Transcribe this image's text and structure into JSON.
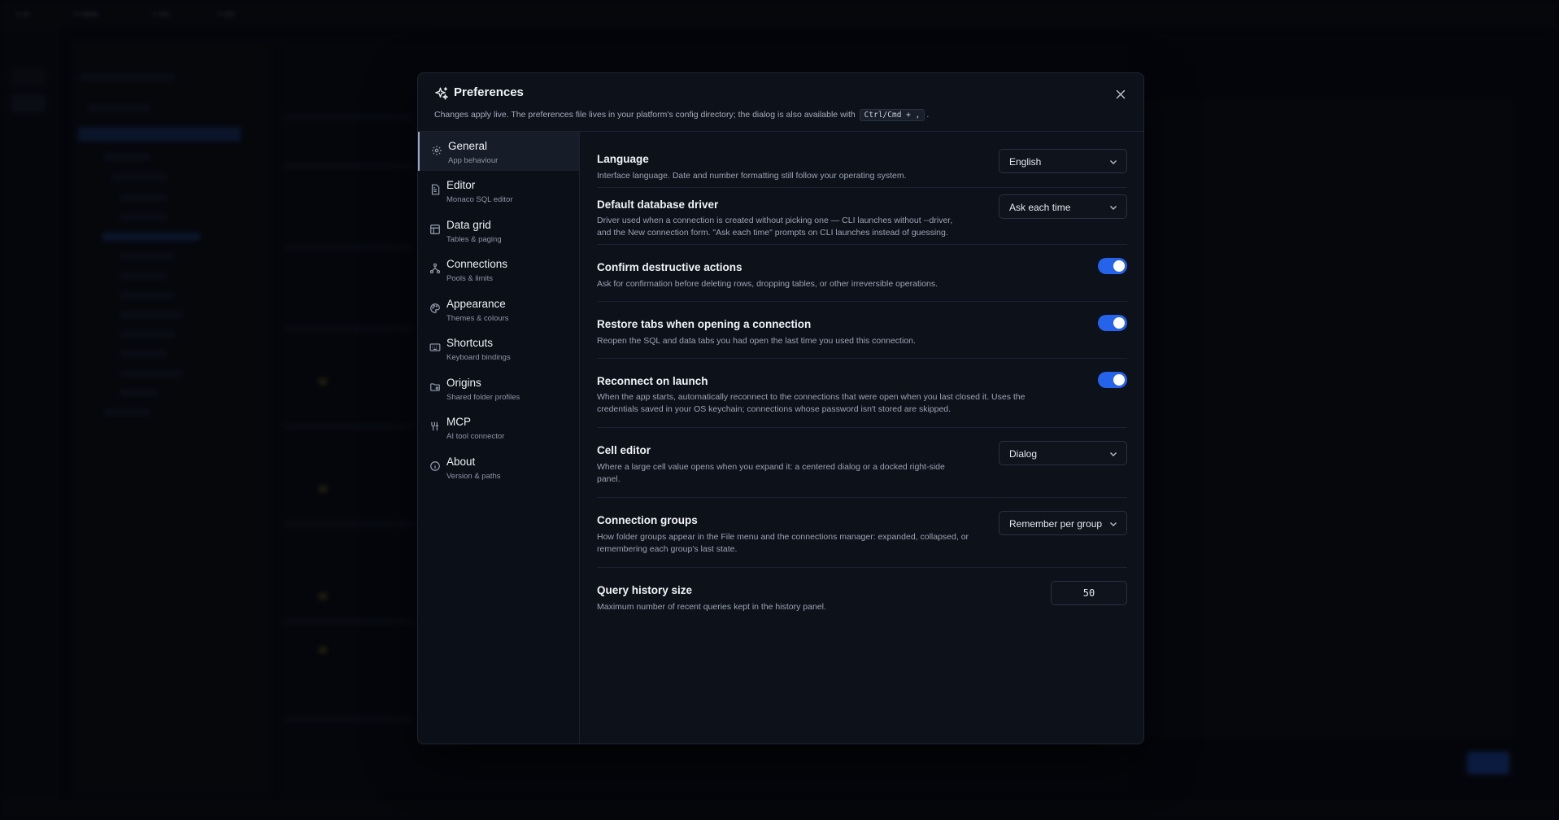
{
  "dialog": {
    "title": "Preferences",
    "subtitle_before": "Changes apply live. The preferences file lives in your platform's config directory; the dialog is also available with",
    "shortcut": "Ctrl/Cmd + ,",
    "subtitle_after": ".",
    "title_icon": "sparkles-icon",
    "close_icon": "close-icon"
  },
  "sidebar": {
    "items": [
      {
        "label": "General",
        "sub": "App behaviour",
        "icon": "gear-icon",
        "active": true
      },
      {
        "label": "Editor",
        "sub": "Monaco SQL editor",
        "icon": "file-code-icon",
        "active": false
      },
      {
        "label": "Data grid",
        "sub": "Tables & paging",
        "icon": "table-icon",
        "active": false
      },
      {
        "label": "Connections",
        "sub": "Pools & limits",
        "icon": "network-icon",
        "active": false
      },
      {
        "label": "Appearance",
        "sub": "Themes & colours",
        "icon": "palette-icon",
        "active": false
      },
      {
        "label": "Shortcuts",
        "sub": "Keyboard bindings",
        "icon": "keyboard-icon",
        "active": false
      },
      {
        "label": "Origins",
        "sub": "Shared folder profiles",
        "icon": "folder-share-icon",
        "active": false
      },
      {
        "label": "MCP",
        "sub": "AI tool connector",
        "icon": "plug-icon",
        "active": false
      },
      {
        "label": "About",
        "sub": "Version & paths",
        "icon": "info-icon",
        "active": false
      }
    ]
  },
  "settings": {
    "language": {
      "title": "Language",
      "desc": "Interface language. Date and number formatting still follow your operating system.",
      "value": "English"
    },
    "driver": {
      "title": "Default database driver",
      "desc1": "Driver used when a connection is created without picking one — CLI launches without --driver,",
      "desc2": "and the New connection form. \"Ask each time\" prompts on CLI launches instead of guessing.",
      "value": "Ask each time"
    },
    "confirm": {
      "title": "Confirm destructive actions",
      "desc": "Ask for confirmation before deleting rows, dropping tables, or other irreversible operations.",
      "enabled": true
    },
    "restore": {
      "title": "Restore tabs when opening a connection",
      "desc": "Reopen the SQL and data tabs you had open the last time you used this connection.",
      "enabled": true
    },
    "reconnect": {
      "title": "Reconnect on launch",
      "desc1": "When the app starts, automatically reconnect to the connections that were open when you last closed it. Uses the",
      "desc2": "credentials saved in your OS keychain; connections whose password isn't stored are skipped.",
      "enabled": true
    },
    "cell_editor": {
      "title": "Cell editor",
      "desc1": "Where a large cell value opens when you expand it: a centered dialog or a docked right-side",
      "desc2": "panel.",
      "value": "Dialog"
    },
    "groups": {
      "title": "Connection groups",
      "desc1": "How folder groups appear in the File menu and the connections manager: expanded, collapsed, or",
      "desc2": "remembering each group's last state.",
      "value": "Remember per group"
    },
    "history": {
      "title": "Query history size",
      "desc": "Maximum number of recent queries kept in the history panel.",
      "value": "50"
    }
  },
  "colors": {
    "accent": "#2563eb",
    "dialog_bg": "#0c111a",
    "page_bg": "#06080d"
  }
}
